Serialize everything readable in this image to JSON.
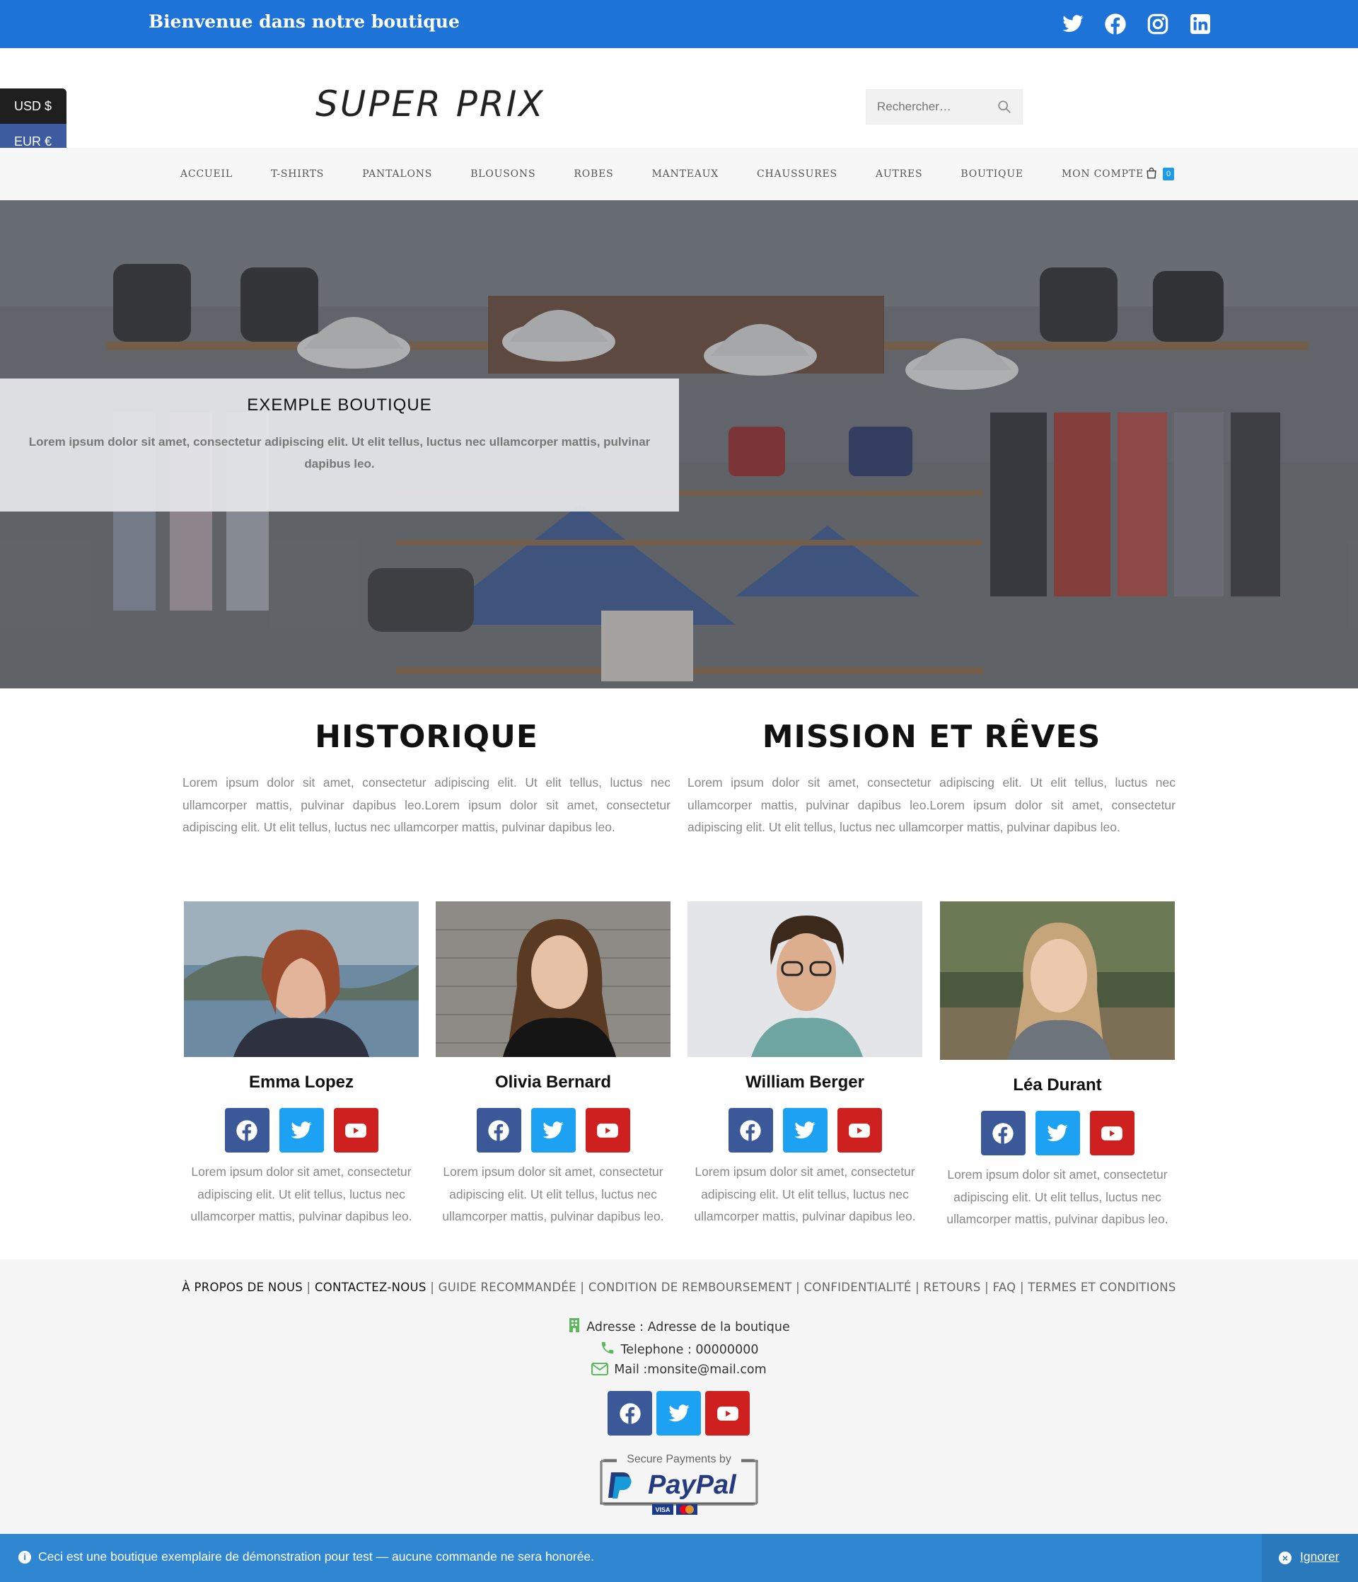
{
  "topbar": {
    "welcome": "Bienvenue dans notre boutique",
    "social_icons": [
      "twitter-icon",
      "facebook-icon",
      "instagram-icon",
      "linkedin-icon"
    ]
  },
  "currency": {
    "usd": "USD $",
    "eur": "EUR €"
  },
  "header": {
    "logo": "SUPER PRIX",
    "search_placeholder": "Rechercher…"
  },
  "nav": {
    "items": [
      "ACCUEIL",
      "T-SHIRTS",
      "PANTALONS",
      "BLOUSONS",
      "ROBES",
      "MANTEAUX",
      "CHAUSSURES",
      "AUTRES",
      "BOUTIQUE",
      "MON COMPTE"
    ],
    "cart_count": "0"
  },
  "hero": {
    "title": "EXEMPLE BOUTIQUE",
    "text": "Lorem ipsum dolor sit amet, consectetur adipiscing elit. Ut elit tellus, luctus nec ullamcorper mattis, pulvinar dapibus leo."
  },
  "about": {
    "historique_title": "HISTORIQUE",
    "historique_text": "Lorem ipsum dolor sit amet, consectetur adipiscing elit. Ut elit tellus, luctus nec ullamcorper mattis, pulvinar dapibus leo.Lorem ipsum dolor sit amet, consectetur adipiscing elit. Ut elit tellus, luctus nec ullamcorper mattis, pulvinar dapibus leo.",
    "mission_title": "MISSION ET RÊVES",
    "mission_text": "Lorem ipsum dolor sit amet, consectetur adipiscing elit. Ut elit tellus, luctus nec ullamcorper mattis, pulvinar dapibus leo.Lorem ipsum dolor sit amet, consectetur adipiscing elit. Ut elit tellus, luctus nec ullamcorper mattis, pulvinar dapibus leo."
  },
  "team": [
    {
      "name": "Emma Lopez",
      "desc": "Lorem ipsum dolor sit amet, consectetur adipiscing elit. Ut elit tellus, luctus nec ullamcorper mattis, pulvinar dapibus leo."
    },
    {
      "name": "Olivia Bernard",
      "desc": "Lorem ipsum dolor sit amet, consectetur adipiscing elit. Ut elit tellus, luctus nec ullamcorper mattis, pulvinar dapibus leo."
    },
    {
      "name": "William Berger",
      "desc": "Lorem ipsum dolor sit amet, consectetur adipiscing elit. Ut elit tellus, luctus nec ullamcorper mattis, pulvinar dapibus leo."
    },
    {
      "name": "Léa Durant",
      "desc": "Lorem ipsum dolor sit amet, consectetur adipiscing elit. Ut elit tellus, luctus nec ullamcorper mattis, pulvinar dapibus leo."
    }
  ],
  "footer": {
    "links": [
      "À PROPOS DE NOUS",
      "CONTACTEZ-NOUS",
      "GUIDE RECOMMANDÉE",
      "CONDITION DE REMBOURSEMENT",
      "CONFIDENTIALITÉ",
      "RETOURS",
      "FAQ",
      "TERMES ET CONDITIONS"
    ],
    "separator": " | ",
    "address": "Adresse : Adresse de la boutique",
    "phone": "Telephone : 00000000",
    "mail": "Mail :monsite@mail.com",
    "paypal_caption": "Secure Payments by",
    "paypal_brand": "PayPal",
    "card_brands": [
      "VISA",
      "mastercard"
    ]
  },
  "notice": {
    "text": "Ceci est une boutique exemplaire de démonstration pour test — aucune commande ne sera honorée.",
    "dismiss": "Ignorer"
  },
  "colors": {
    "topbar": "#1e73d8",
    "facebook": "#3b5998",
    "twitter": "#1da1f2",
    "youtube": "#cd201f",
    "notice": "#2f87d1",
    "contact_icons": "#5cb85c"
  }
}
